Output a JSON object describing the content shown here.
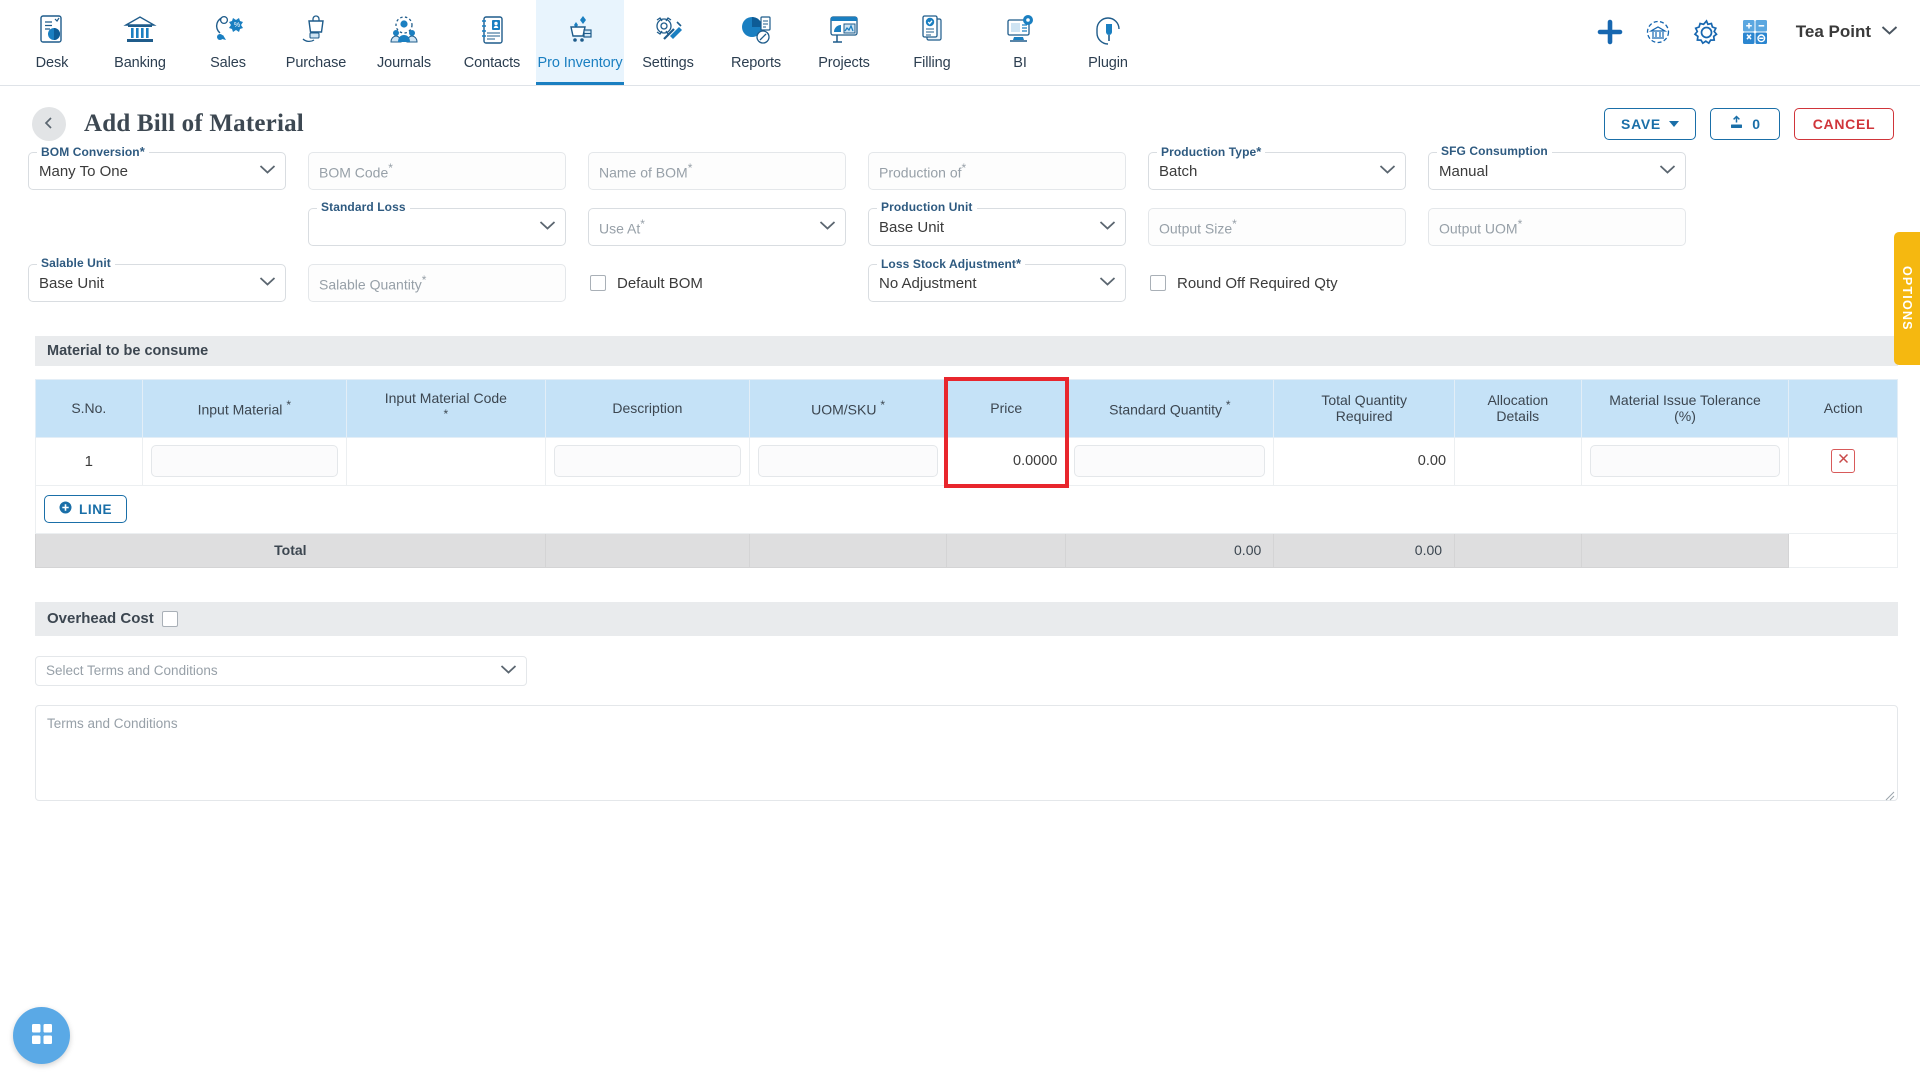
{
  "topnav": {
    "items": [
      {
        "label": "Desk",
        "icon": "desk-dashboard-icon",
        "active": false
      },
      {
        "label": "Banking",
        "icon": "bank-icon",
        "active": false
      },
      {
        "label": "Sales",
        "icon": "sales-tag-icon",
        "active": false
      },
      {
        "label": "Purchase",
        "icon": "purchase-bag-icon",
        "active": false
      },
      {
        "label": "Journals",
        "icon": "journals-people-gear-icon",
        "active": false
      },
      {
        "label": "Contacts",
        "icon": "contacts-book-icon",
        "active": false
      },
      {
        "label": "Pro Inventory",
        "icon": "pro-inventory-cart-icon",
        "active": true
      },
      {
        "label": "Settings",
        "icon": "settings-tools-icon",
        "active": false
      },
      {
        "label": "Reports",
        "icon": "reports-piechart-icon",
        "active": false
      },
      {
        "label": "Projects",
        "icon": "projects-chart-icon",
        "active": false
      },
      {
        "label": "Filling",
        "icon": "filling-documents-icon",
        "active": false
      },
      {
        "label": "BI",
        "icon": "bi-monitor-icon",
        "active": false
      },
      {
        "label": "Plugin",
        "icon": "plugin-plug-icon",
        "active": false
      }
    ],
    "actions": [
      {
        "icon": "plus-icon",
        "name": "add-new-button"
      },
      {
        "icon": "bank-sync-icon",
        "name": "bank-sync-button"
      },
      {
        "icon": "gear-icon",
        "name": "settings-button"
      },
      {
        "icon": "calculator-icon",
        "name": "calculator-button"
      }
    ],
    "user": {
      "name": "Tea Point",
      "chevron": "chevron-down-icon"
    },
    "accent": "#1a7fc1",
    "active_bg": "#e8f4fd"
  },
  "header": {
    "back_icon": "chevron-left-icon",
    "title": "Add Bill of Material",
    "buttons": {
      "save": "SAVE",
      "attach_count": "0",
      "attach_icon": "upload-icon",
      "cancel": "CANCEL"
    },
    "colors": {
      "primary": "#1a6fa8",
      "danger": "#d0353a"
    }
  },
  "options_tab": {
    "label": "OPTIONS",
    "color": "#f5b810"
  },
  "form": {
    "fields": [
      {
        "name": "bom-conversion",
        "label": "BOM Conversion",
        "required": true,
        "type": "select",
        "value": "Many To One",
        "row": 1,
        "col": 1
      },
      {
        "name": "bom-code",
        "label": "",
        "placeholder": "BOM Code",
        "required": true,
        "type": "text",
        "value": "",
        "row": 1,
        "col": 2
      },
      {
        "name": "name-of-bom",
        "label": "",
        "placeholder": "Name of BOM",
        "required": true,
        "type": "text",
        "value": "",
        "row": 1,
        "col": 3
      },
      {
        "name": "production-of",
        "label": "",
        "placeholder": "Production of",
        "required": true,
        "type": "text",
        "value": "",
        "row": 1,
        "col": 4
      },
      {
        "name": "production-type",
        "label": "Production Type",
        "required": true,
        "type": "select",
        "value": "Batch",
        "row": 1,
        "col": 5
      },
      {
        "name": "sfg-consumption",
        "label": "SFG Consumption",
        "required": false,
        "type": "select",
        "value": "Manual",
        "row": 1,
        "col": 6
      },
      {
        "name": "standard-loss",
        "label": "Standard Loss",
        "required": false,
        "type": "select",
        "value": "",
        "row": 2,
        "col": 2
      },
      {
        "name": "use-at",
        "label": "",
        "placeholder": "Use At",
        "required": true,
        "type": "select",
        "value": "",
        "row": 2,
        "col": 3
      },
      {
        "name": "production-unit",
        "label": "Production Unit",
        "required": false,
        "type": "select",
        "value": "Base Unit",
        "row": 2,
        "col": 4
      },
      {
        "name": "output-size",
        "label": "",
        "placeholder": "Output Size",
        "required": true,
        "type": "text",
        "value": "",
        "row": 2,
        "col": 5
      },
      {
        "name": "output-uom",
        "label": "",
        "placeholder": "Output UOM",
        "required": true,
        "type": "text",
        "value": "",
        "row": 2,
        "col": 6
      },
      {
        "name": "salable-unit",
        "label": "Salable Unit",
        "required": false,
        "type": "select",
        "value": "Base Unit",
        "row": 3,
        "col": 1
      },
      {
        "name": "salable-quantity",
        "label": "",
        "placeholder": "Salable Quantity",
        "required": true,
        "type": "text",
        "value": "",
        "row": 3,
        "col": 2
      },
      {
        "name": "loss-stock-adjustment",
        "label": "Loss Stock Adjustment",
        "required": true,
        "type": "select",
        "value": "No Adjustment",
        "row": 3,
        "col": 4
      }
    ],
    "checkboxes": [
      {
        "name": "default-bom-checkbox",
        "label": "Default BOM",
        "checked": false
      },
      {
        "name": "round-off-required-qty-checkbox",
        "label": "Round Off Required Qty",
        "checked": false
      }
    ]
  },
  "material_section": {
    "title": "Material to be consume",
    "columns": [
      {
        "label": "S.No.",
        "required": false
      },
      {
        "label": "Input Material",
        "required": true
      },
      {
        "label": "Input Material Code",
        "required": true
      },
      {
        "label": "Description",
        "required": false
      },
      {
        "label": "UOM/SKU",
        "required": true
      },
      {
        "label": "Price",
        "required": false,
        "highlighted": true
      },
      {
        "label": "Standard Quantity",
        "required": true
      },
      {
        "label": "Total Quantity\nRequired",
        "required": false
      },
      {
        "label": "Allocation\nDetails",
        "required": false
      },
      {
        "label": "Material Issue Tolerance\n(%)",
        "required": false
      },
      {
        "label": "Action",
        "required": false
      }
    ],
    "rows": [
      {
        "sno": "1",
        "input_material": "",
        "input_material_code": "",
        "description": "",
        "uom_sku": "",
        "price": "0.0000",
        "standard_quantity": "",
        "total_quantity_required": "0.00",
        "allocation_details": "",
        "material_issue_tolerance": "",
        "action_icon": "delete-x-icon"
      }
    ],
    "add_line_button": {
      "label": "LINE",
      "icon": "plus-circle-icon"
    },
    "total_row": {
      "label": "Total",
      "standard_quantity": "0.00",
      "total_quantity_required": "0.00"
    },
    "highlight_color": "#e8262d",
    "header_bg": "#c5e2f7"
  },
  "overhead": {
    "title": "Overhead Cost",
    "checked": false
  },
  "terms": {
    "select_placeholder": "Select Terms and Conditions",
    "select_value": "",
    "textarea_placeholder": "Terms and Conditions",
    "textarea_value": ""
  },
  "fab": {
    "icon": "grid-apps-icon",
    "color": "#5aa9e6"
  }
}
